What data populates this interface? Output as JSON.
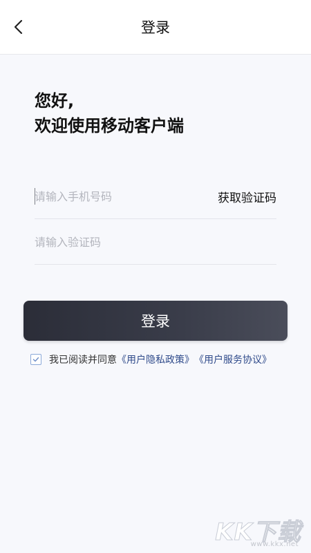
{
  "header": {
    "title": "登录",
    "back_icon": "chevron-left-icon"
  },
  "greeting": {
    "line1": "您好,",
    "line2": "欢迎使用移动客户端"
  },
  "form": {
    "phone_placeholder": "请输入手机号码",
    "phone_value": "",
    "get_code_label": "获取验证码",
    "code_placeholder": "请输入验证码",
    "code_value": ""
  },
  "login_button": {
    "label": "登录"
  },
  "agreement": {
    "checked": true,
    "prefix": "我已阅读并同意",
    "privacy_link": "《用户隐私政策》",
    "service_link": "《用户服务协议》"
  },
  "watermark": {
    "logo": "KK下载",
    "url": "www.kkx.net"
  },
  "colors": {
    "background": "#f7f8fc",
    "button": "#2b2d38",
    "link": "#2f4a8a",
    "checkbox": "#8aa8d8"
  }
}
